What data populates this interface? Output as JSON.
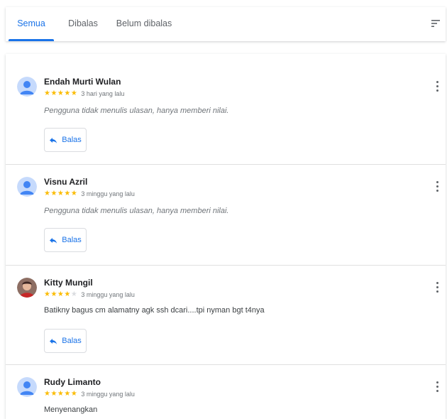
{
  "tabs": [
    {
      "label": "Semua",
      "active": true
    },
    {
      "label": "Dibalas",
      "active": false
    },
    {
      "label": "Belum dibalas",
      "active": false
    }
  ],
  "filter_icon": "filter-list-icon",
  "reply_label": "Balas",
  "reviews": [
    {
      "name": "Endah Murti Wulan",
      "rating": 5,
      "time": "3 hari yang lalu",
      "text": "Pengguna tidak menulis ulasan, hanya memberi nilai.",
      "italic": true,
      "avatar": "default-avatar-icon"
    },
    {
      "name": "Visnu Azril",
      "rating": 5,
      "time": "3 minggu yang lalu",
      "text": "Pengguna tidak menulis ulasan, hanya memberi nilai.",
      "italic": true,
      "avatar": "default-avatar-icon"
    },
    {
      "name": "Kitty Mungil",
      "rating": 4,
      "time": "3 minggu yang lalu",
      "text": "Batikny bagus cm alamatny agk ssh dcari....tpi nyman bgt t4nya",
      "italic": false,
      "avatar": "photo-avatar"
    },
    {
      "name": "Rudy Limanto",
      "rating": 5,
      "time": "3 minggu yang lalu",
      "text": "Menyenangkan",
      "italic": false,
      "avatar": "default-avatar-icon"
    }
  ],
  "colors": {
    "accent": "#1a73e8",
    "star": "#fbbc04",
    "avatar_bg": "#c6dafc",
    "avatar_fg": "#4285f4"
  }
}
